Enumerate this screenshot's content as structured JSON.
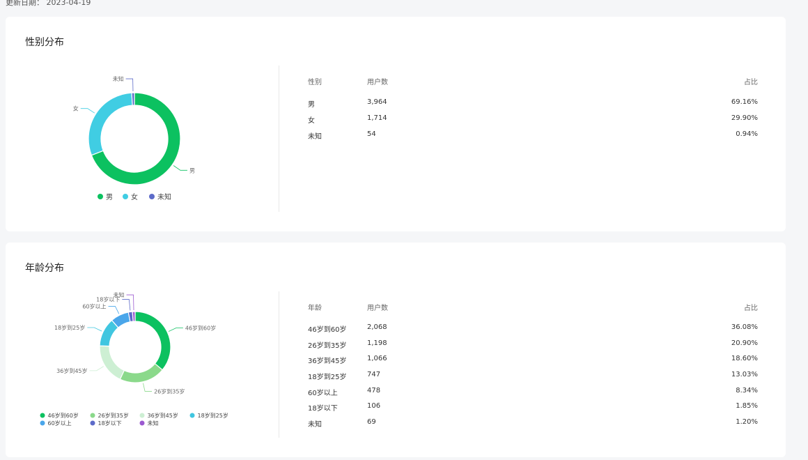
{
  "update": {
    "label": "更新日期：",
    "date": "2023-04-19"
  },
  "gender": {
    "title": "性别分布",
    "headers": {
      "name": "性别",
      "users": "用户数",
      "pct": "占比"
    },
    "rows": [
      {
        "name": "男",
        "users": "3,964",
        "pct": "69.16%"
      },
      {
        "name": "女",
        "users": "1,714",
        "pct": "29.90%"
      },
      {
        "name": "未知",
        "users": "54",
        "pct": "0.94%"
      }
    ]
  },
  "age": {
    "title": "年龄分布",
    "headers": {
      "name": "年龄",
      "users": "用户数",
      "pct": "占比"
    },
    "rows": [
      {
        "name": "46岁到60岁",
        "users": "2,068",
        "pct": "36.08%"
      },
      {
        "name": "26岁到35岁",
        "users": "1,198",
        "pct": "20.90%"
      },
      {
        "name": "36岁到45岁",
        "users": "1,066",
        "pct": "18.60%"
      },
      {
        "name": "18岁到25岁",
        "users": "747",
        "pct": "13.03%"
      },
      {
        "name": "60岁以上",
        "users": "478",
        "pct": "8.34%"
      },
      {
        "name": "18岁以下",
        "users": "106",
        "pct": "1.85%"
      },
      {
        "name": "未知",
        "users": "69",
        "pct": "1.20%"
      }
    ]
  },
  "chart_data": [
    {
      "type": "pie",
      "variant": "donut",
      "title": "性别分布",
      "categories": [
        "男",
        "女",
        "未知"
      ],
      "values": [
        3964,
        1714,
        54
      ],
      "colors": [
        "#0cc160",
        "#40cde3",
        "#5d6bc9"
      ],
      "legend": "bottom"
    },
    {
      "type": "pie",
      "variant": "donut",
      "title": "年龄分布",
      "categories": [
        "46岁到60岁",
        "26岁到35岁",
        "36岁到45岁",
        "18岁到25岁",
        "60岁以上",
        "18岁以下",
        "未知"
      ],
      "values": [
        2068,
        1198,
        1066,
        747,
        478,
        106,
        69
      ],
      "colors": [
        "#0cc160",
        "#8bd98b",
        "#cdefd3",
        "#40c6e0",
        "#4aa6ea",
        "#5d6bc9",
        "#9b59d0"
      ],
      "legend": "bottom"
    }
  ]
}
